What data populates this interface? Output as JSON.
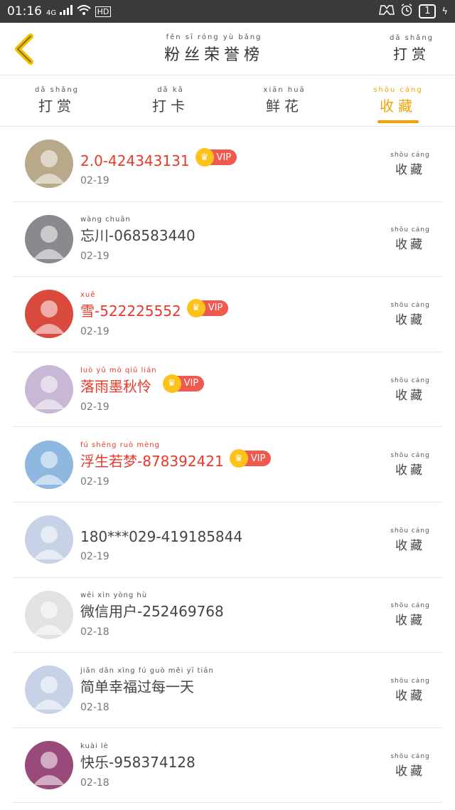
{
  "status_bar": {
    "time": "01:16",
    "signal": "4G",
    "hd": "HD",
    "battery": "1"
  },
  "header": {
    "title": {
      "pinyin": "fěn  sī  róng  yù  bǎng",
      "text": "粉丝荣誉榜"
    },
    "action": {
      "pinyin": "dǎ  shǎng",
      "text": "打赏"
    }
  },
  "tabs": [
    {
      "pinyin": "dǎ  shǎng",
      "text": "打赏"
    },
    {
      "pinyin": "dǎ  kǎ",
      "text": "打卡"
    },
    {
      "pinyin": "xiān  huā",
      "text": "鲜花"
    },
    {
      "pinyin": "shōu  cáng",
      "text": "收藏"
    }
  ],
  "active_tab": 3,
  "action_label": {
    "pinyin": "shōu  cáng",
    "text": "收藏"
  },
  "vip_label": "VIP",
  "fans": [
    {
      "pinyin": "",
      "name": "2.0-424343131",
      "vip": true,
      "date": "02-19",
      "avatar_color": "#b8a98a"
    },
    {
      "pinyin": "wàng chuān",
      "name": "忘川-068583440",
      "vip": false,
      "date": "02-19",
      "avatar_color": "#8a8a8e"
    },
    {
      "pinyin": "xuě",
      "name": "雪-522225552",
      "vip": true,
      "date": "02-19",
      "avatar_color": "#d94a3c"
    },
    {
      "pinyin": "luò yǔ mò qiū lián",
      "name": "落雨墨秋怜",
      "vip": true,
      "date": "02-19",
      "avatar_color": "#c9b7d6"
    },
    {
      "pinyin": "fú shēng ruò mèng",
      "name": "浮生若梦-878392421",
      "vip": true,
      "date": "02-19",
      "avatar_color": "#8fb8e0"
    },
    {
      "pinyin": "",
      "name": "180***029-419185844",
      "vip": false,
      "date": "02-19",
      "avatar_color": "#c8d2e6"
    },
    {
      "pinyin": "wēi xìn yòng hù",
      "name": "微信用户-252469768",
      "vip": false,
      "date": "02-18",
      "avatar_color": "#e2e2e2"
    },
    {
      "pinyin": "jiǎn dān xìng fú guò měi yī tiān",
      "name": "简单幸福过每一天",
      "vip": false,
      "date": "02-18",
      "avatar_color": "#c8d2e6"
    },
    {
      "pinyin": "kuài lè",
      "name": "快乐-958374128",
      "vip": false,
      "date": "02-18",
      "avatar_color": "#9a4a7a"
    }
  ]
}
